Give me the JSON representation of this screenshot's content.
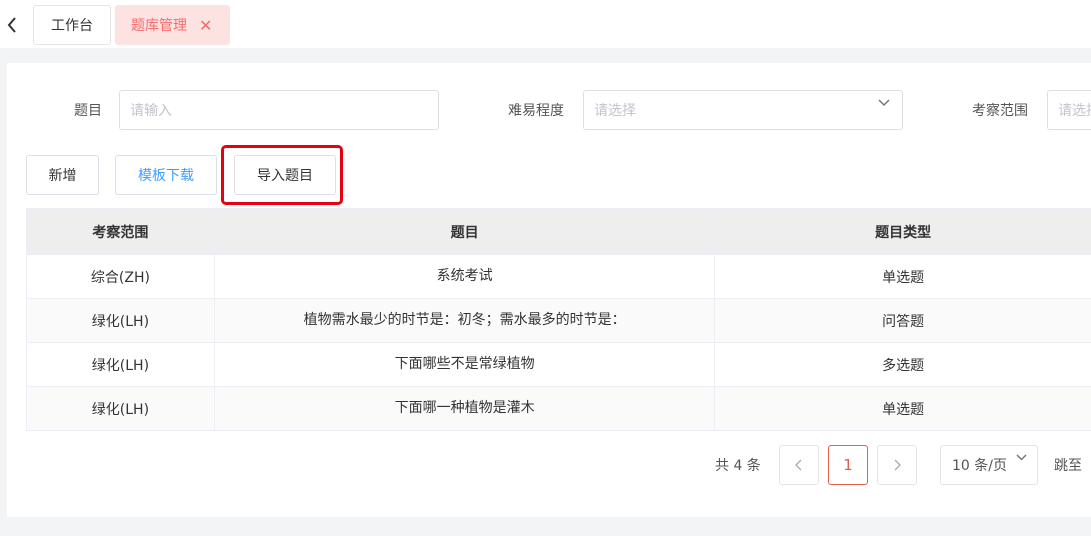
{
  "tabs": [
    {
      "label": "工作台"
    },
    {
      "label": "题库管理",
      "close": "✕"
    }
  ],
  "filters": {
    "title_label": "题目",
    "title_placeholder": "请输入",
    "difficulty_label": "难易程度",
    "difficulty_placeholder": "请选择",
    "scope_label": "考察范围",
    "scope_placeholder": "请选择"
  },
  "toolbar": {
    "add": "新增",
    "template": "模板下载",
    "import": "导入题目"
  },
  "table": {
    "headers": [
      "考察范围",
      "题目",
      "题目类型"
    ],
    "rows": [
      [
        "综合(ZH)",
        "系统考试",
        "单选题"
      ],
      [
        "绿化(LH)",
        "植物需水最少的时节是：初冬；需水最多的时节是：",
        "问答题"
      ],
      [
        "绿化(LH)",
        "下面哪些不是常绿植物",
        "多选题"
      ],
      [
        "绿化(LH)",
        "下面哪一种植物是灌木",
        "单选题"
      ]
    ]
  },
  "pagination": {
    "total": "共 4 条",
    "current": "1",
    "page_size": "10 条/页",
    "jump": "跳至"
  },
  "colors": {
    "highlight": "#e60012",
    "accent_blue": "#409eff",
    "active_tab_bg": "#fde2e2",
    "active_tab_text": "#f56c6c"
  }
}
